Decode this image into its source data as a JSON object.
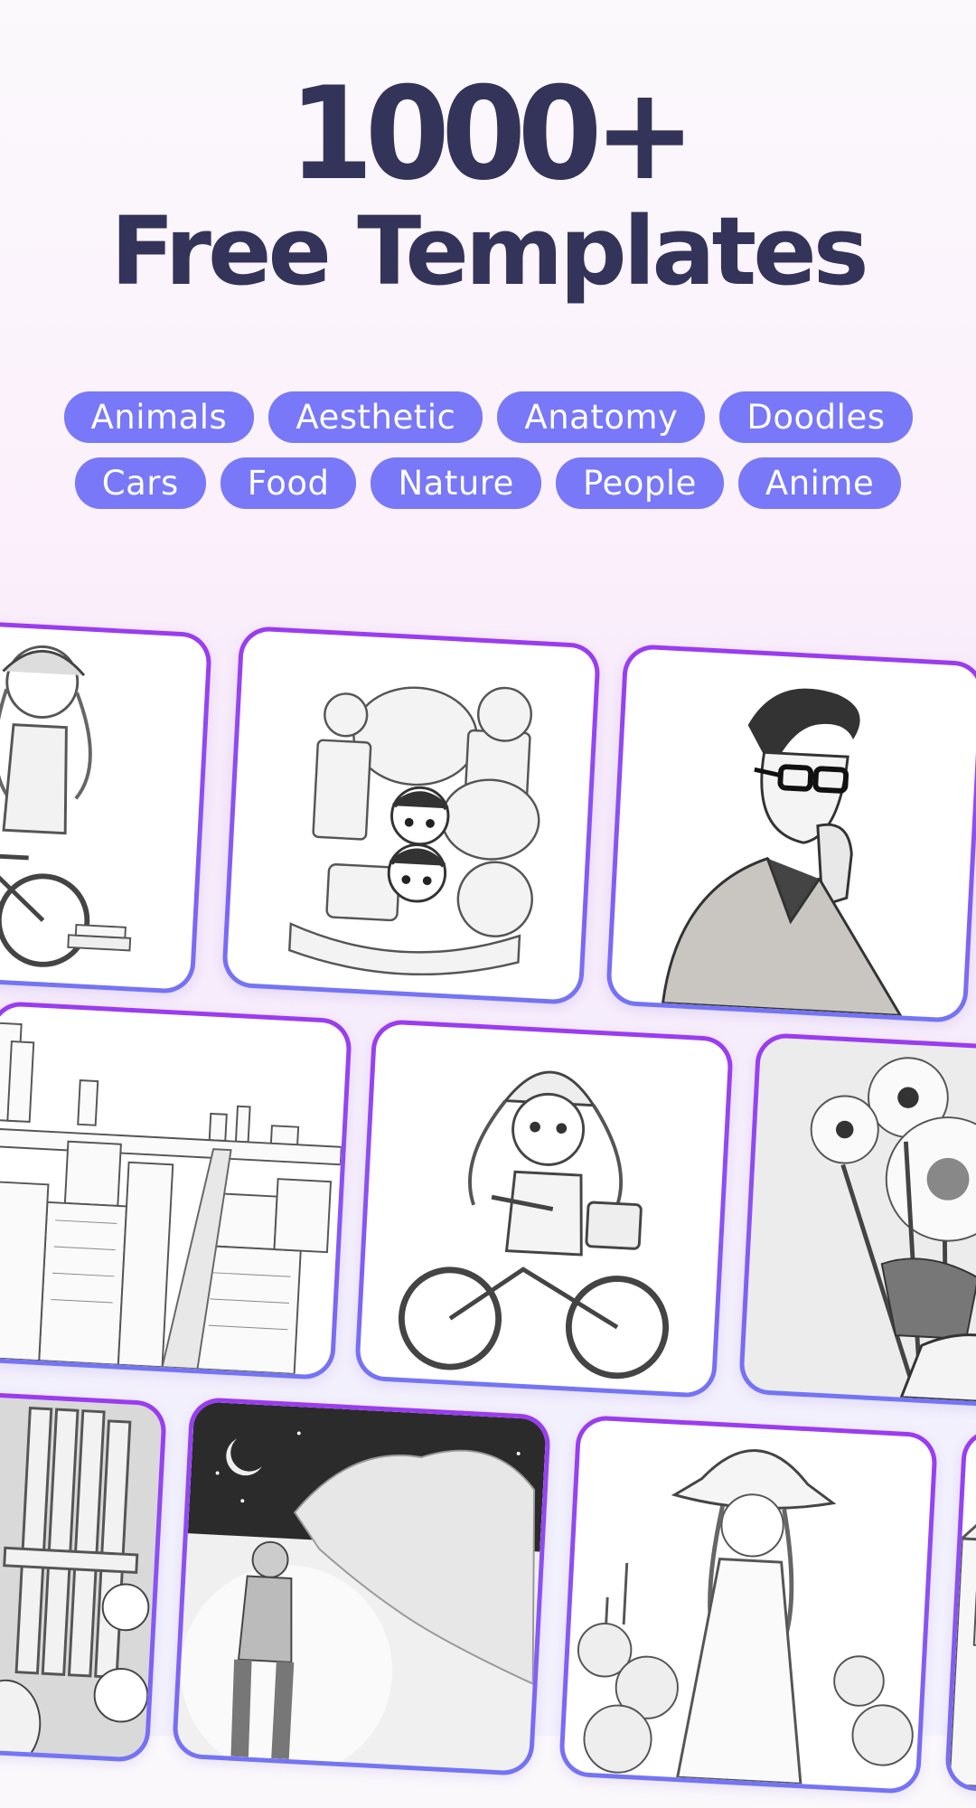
{
  "header": {
    "headline_number": "1000+",
    "headline_text": "Free Templates"
  },
  "categories": {
    "row1": [
      "Animals",
      "Aesthetic",
      "Anatomy",
      "Doodles"
    ],
    "row2": [
      "Cars",
      "Food",
      "Nature",
      "People",
      "Anime"
    ]
  },
  "colors": {
    "headline": "#343359",
    "chip_background": "#7878f8",
    "chip_text": "#ffffff",
    "card_border_top": "#9b3bf0",
    "card_border_bottom": "#7474f5"
  },
  "templates": [
    {
      "subject": "girl-on-bicycle-with-books",
      "style": "pencil sketch"
    },
    {
      "subject": "doodle-kids-and-monsters",
      "style": "doodle line art"
    },
    {
      "subject": "man-with-glasses-thinking",
      "style": "ink portrait"
    },
    {
      "subject": "city-street-aerial-view",
      "style": "pencil sketch"
    },
    {
      "subject": "girl-in-beanie-riding-bicycle",
      "style": "anime line art"
    },
    {
      "subject": "bouquet-of-daisies-in-hand",
      "style": "pencil sketch"
    },
    {
      "subject": "girl-on-wooden-chair-with-dog-and-flowers",
      "style": "grayscale"
    },
    {
      "subject": "boy-looking-at-night-sky-clouds",
      "style": "grayscale"
    },
    {
      "subject": "girl-in-hat-in-flower-garden",
      "style": "pencil sketch"
    },
    {
      "subject": "house-facade",
      "style": "line art"
    }
  ]
}
